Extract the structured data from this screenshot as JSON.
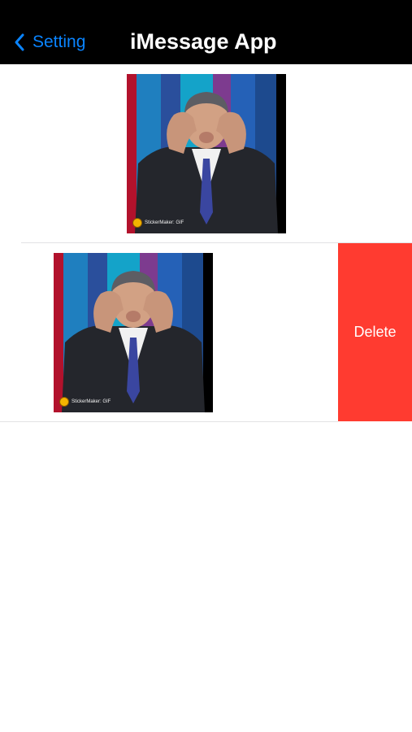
{
  "nav": {
    "back_label": "Setting",
    "title": "iMessage App",
    "back_icon": "chevron-left-icon",
    "accent_color": "#0A84FF"
  },
  "stickers": [
    {
      "watermark": "StickerMaker: GIF"
    },
    {
      "watermark": "StickerMaker: GIF"
    }
  ],
  "row_actions": {
    "delete_label": "Delete",
    "delete_color": "#FF3B30"
  }
}
